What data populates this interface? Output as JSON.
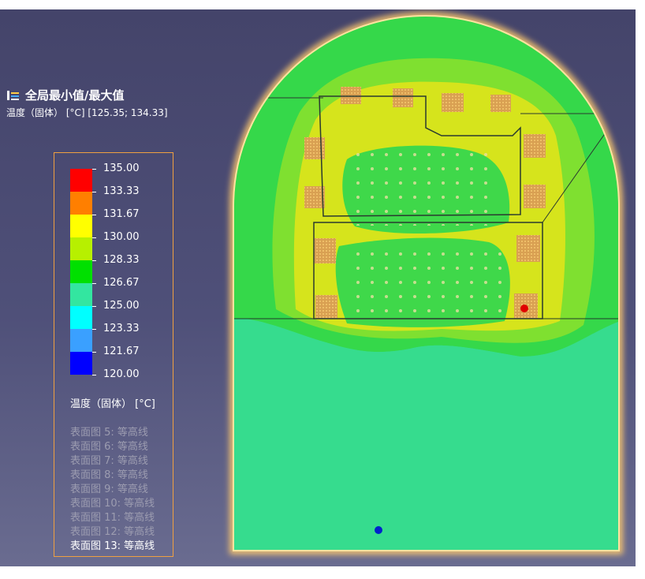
{
  "header": {
    "title": "全局最小值/最大值",
    "subtitle": "温度（固体） [°C] [125.35; 134.33]"
  },
  "legend": {
    "ticks": [
      "135.00",
      "133.33",
      "131.67",
      "130.00",
      "128.33",
      "126.67",
      "125.00",
      "123.33",
      "121.67",
      "120.00"
    ],
    "colors": [
      "#ff0000",
      "#ff7f00",
      "#ffff00",
      "#b7f000",
      "#00e000",
      "#33e6a0",
      "#00ffff",
      "#3aa0ff",
      "#0000ff"
    ],
    "unit_label": "温度（固体） [°C]"
  },
  "surface_plots": [
    {
      "label": "表面图 5: 等高线",
      "active": false
    },
    {
      "label": "表面图 6: 等高线",
      "active": false
    },
    {
      "label": "表面图 7: 等高线",
      "active": false
    },
    {
      "label": "表面图 8: 等高线",
      "active": false
    },
    {
      "label": "表面图 9: 等高线",
      "active": false
    },
    {
      "label": "表面图 10: 等高线",
      "active": false
    },
    {
      "label": "表面图 11: 等高线",
      "active": false
    },
    {
      "label": "表面图 12: 等高线",
      "active": false
    },
    {
      "label": "表面图 13: 等高线",
      "active": true
    }
  ],
  "colors": {
    "background": "#4a4a72",
    "legend_border": "#f0a040",
    "domain_base": "#37dc8c",
    "domain_edge_glow": "#ffd27a"
  },
  "icons": {
    "title_icon": "grid-axes-icon"
  }
}
